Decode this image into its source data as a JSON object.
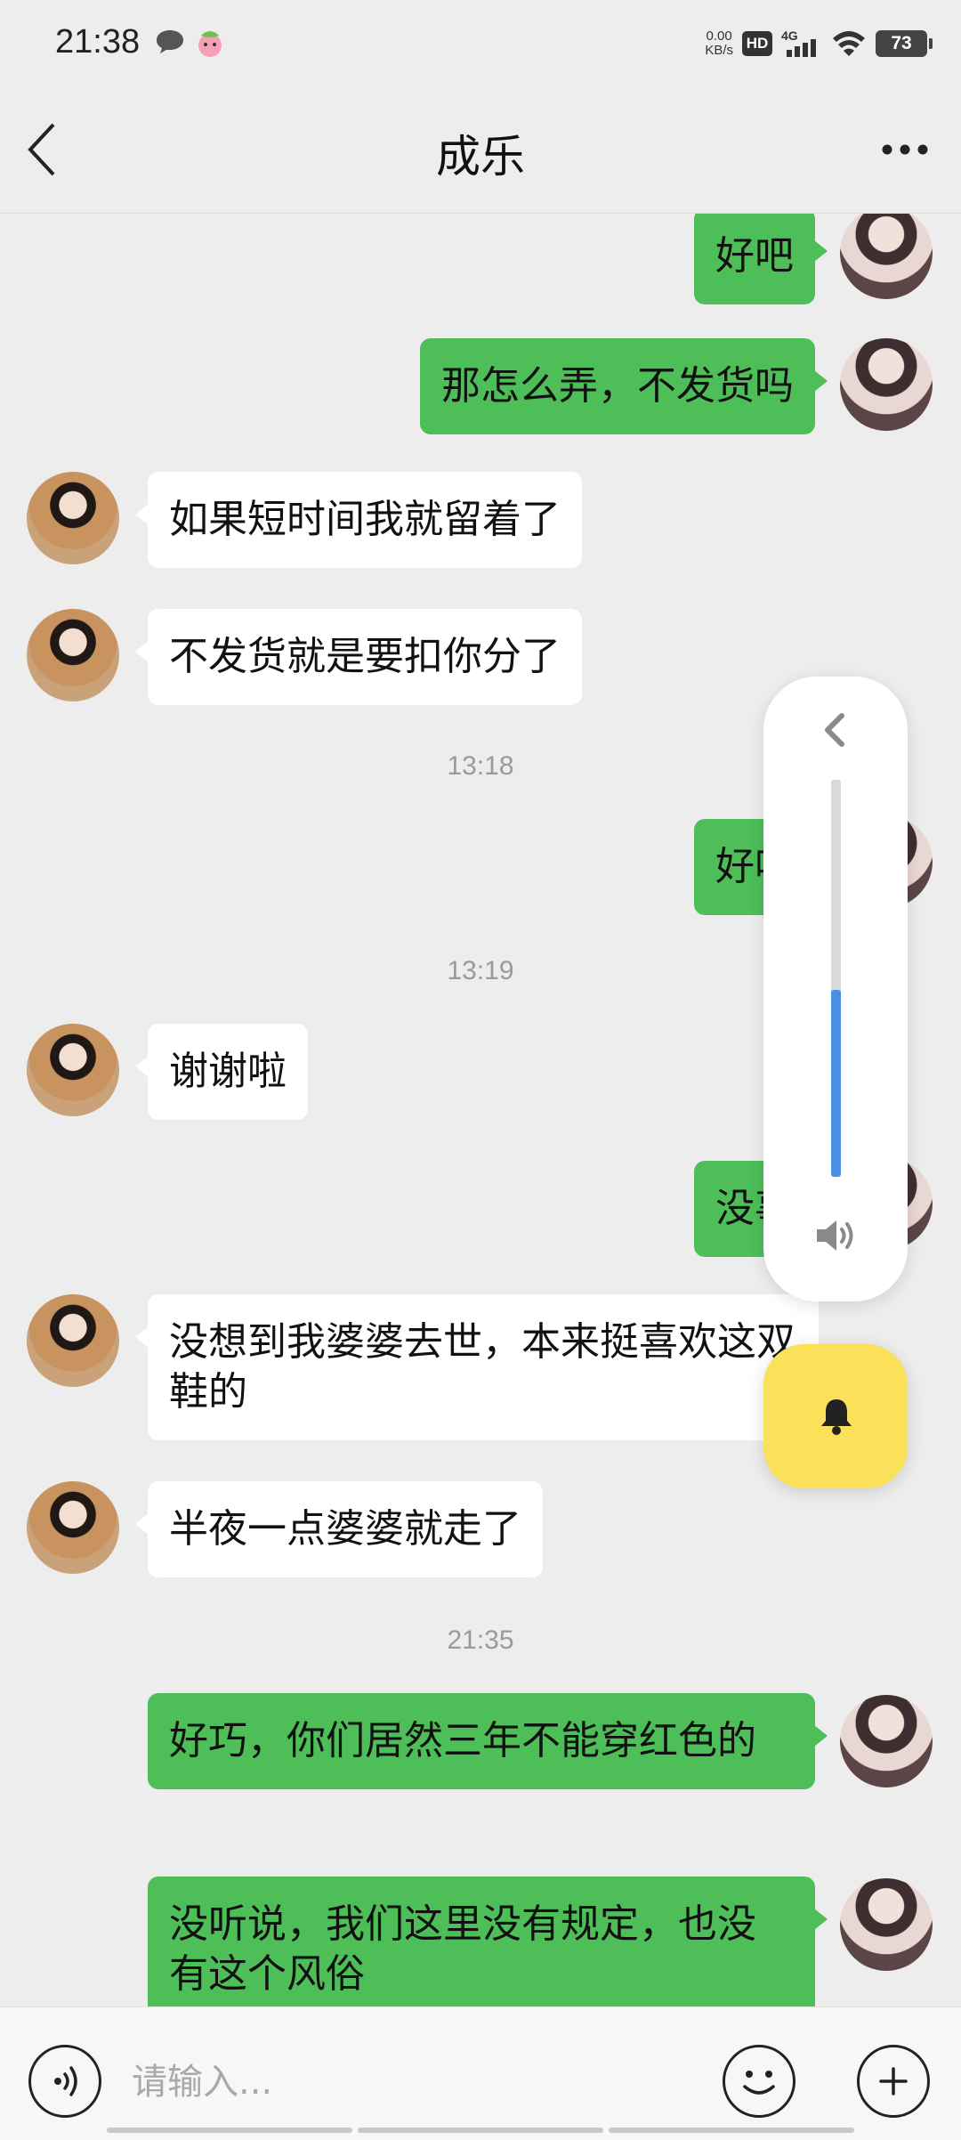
{
  "status_bar": {
    "time": "21:38",
    "net_speed_value": "0.00",
    "net_speed_unit": "KB/s",
    "hd_label": "HD",
    "network_type": "4G",
    "battery": "73"
  },
  "header": {
    "title": "成乐",
    "back_icon": "chevron-left-icon",
    "more_icon": "more-dots-icon"
  },
  "messages": [
    {
      "sender": "self",
      "text": "好吧"
    },
    {
      "sender": "self",
      "text": "那怎么弄，不发货吗"
    },
    {
      "sender": "friend",
      "text": "如果短时间我就留着了"
    },
    {
      "sender": "friend",
      "text": "不发货就是要扣你分了"
    },
    {
      "type": "time",
      "text": "13:18"
    },
    {
      "sender": "self",
      "text": "好吧"
    },
    {
      "type": "time",
      "text": "13:19"
    },
    {
      "sender": "friend",
      "text": "谢谢啦"
    },
    {
      "sender": "self",
      "text": "没事"
    },
    {
      "sender": "friend",
      "text": "没想到我婆婆去世，本来挺喜欢这双鞋的"
    },
    {
      "sender": "friend",
      "text": "半夜一点婆婆就走了"
    },
    {
      "type": "time",
      "text": "21:35"
    },
    {
      "sender": "self",
      "text": "好巧，你们居然三年不能穿红色的"
    },
    {
      "sender": "self",
      "text": "没听说，我们这里没有规定，也没有这个风俗"
    }
  ],
  "volume_overlay": {
    "level": 0.47,
    "accent_color": "#4a8ee6",
    "bell_button_color": "#fbe05a"
  },
  "input": {
    "placeholder": "请输入...",
    "value": ""
  },
  "colors": {
    "self_bubble": "#4dbe58",
    "friend_bubble": "#ffffff",
    "background": "#ededed"
  }
}
